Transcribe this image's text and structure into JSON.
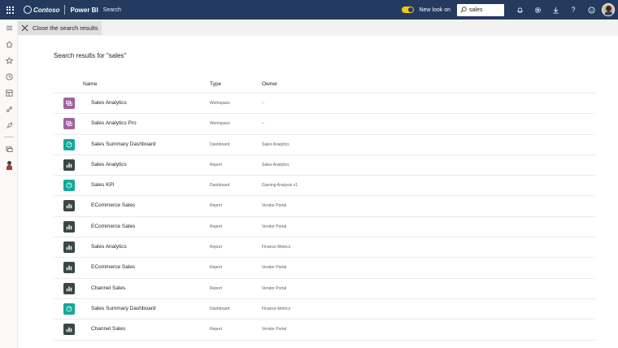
{
  "topbar": {
    "brand": "Contoso",
    "product": "Power BI",
    "crumb": "Search",
    "new_look_label": "New look on",
    "search_value": "sales"
  },
  "icons": {
    "waffle": "app-launcher-icon",
    "search": "search-icon",
    "notifications": "bell-icon",
    "settings": "gear-icon",
    "download": "download-icon",
    "help": "help-icon",
    "feedback": "smiley-icon"
  },
  "rail": [
    "menu-icon",
    "home-icon",
    "star-icon",
    "clock-icon",
    "apps-icon",
    "share-icon",
    "rocket-icon",
    "workspaces-icon",
    "user-avatar"
  ],
  "command_bar": {
    "close_label": "Close the search results"
  },
  "results": {
    "title": "Search results for \"sales\"",
    "columns": [
      "Name",
      "Type",
      "Owner"
    ],
    "rows": [
      {
        "name": "Sales Analytics",
        "type": "Workspace",
        "owner": "--",
        "icon": "workspace"
      },
      {
        "name": "Sales Analytics Pro",
        "type": "Workspace",
        "owner": "--",
        "icon": "workspace"
      },
      {
        "name": "Sales Summary Dashboard",
        "type": "Dashboard",
        "owner": "Sales Analytics",
        "icon": "dashboard"
      },
      {
        "name": "Sales Analytics",
        "type": "Report",
        "owner": "Sales Analytics",
        "icon": "report"
      },
      {
        "name": "Sales KPI",
        "type": "Dashboard",
        "owner": "Gaming Analysis v1",
        "icon": "dashboard"
      },
      {
        "name": "ECommerce Sales",
        "type": "Report",
        "owner": "Vendor Portal",
        "icon": "report"
      },
      {
        "name": "ECommerce Sales",
        "type": "Report",
        "owner": "Vendor Portal",
        "icon": "report"
      },
      {
        "name": "Sales Analytics",
        "type": "Report",
        "owner": "Finance Metrics",
        "icon": "report"
      },
      {
        "name": "ECommerce Sales",
        "type": "Report",
        "owner": "Vendor Portal",
        "icon": "report"
      },
      {
        "name": "Channel Sales",
        "type": "Report",
        "owner": "Vendor Portal",
        "icon": "report"
      },
      {
        "name": "Sales Summary Dashboard",
        "type": "Dashboard",
        "owner": "Finance Metrics",
        "icon": "dashboard"
      },
      {
        "name": "Channel Sales",
        "type": "Report",
        "owner": "Vendor Portal",
        "icon": "report"
      }
    ]
  },
  "colors": {
    "topbar": "#243a5e",
    "workspace": "#a0619d",
    "dashboard": "#14a89c",
    "report": "#3b4646",
    "toggle": "#f2c811"
  }
}
